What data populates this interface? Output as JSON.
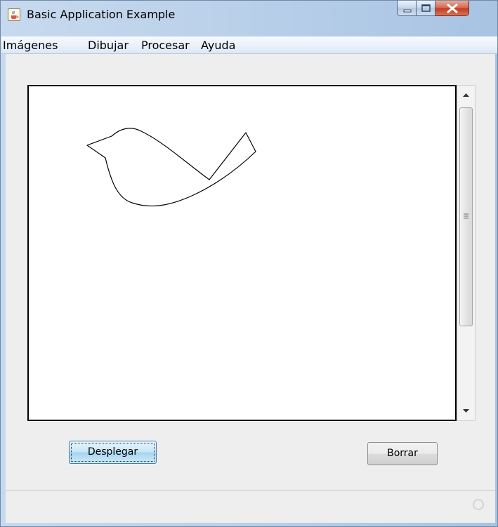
{
  "window": {
    "title": "Basic Application Example",
    "icon": "java-cup-icon"
  },
  "caption_buttons": {
    "minimize": "minimize-icon",
    "maximize": "maximize-icon",
    "close": "close-icon"
  },
  "menubar": {
    "items": [
      {
        "label": "Imágenes"
      },
      {
        "label": "Dibujar"
      },
      {
        "label": "Procesar"
      },
      {
        "label": "Ayuda"
      }
    ]
  },
  "canvas": {
    "drawing": "bird-outline"
  },
  "scrollbar": {
    "up": "scroll-up-arrow-icon",
    "down": "scroll-down-arrow-icon"
  },
  "buttons": {
    "desplegar": "Desplegar",
    "borrar": "Borrar"
  },
  "statusbar": {
    "indicator": "busy-indicator-icon"
  },
  "colors": {
    "canvas_border": "#000000",
    "canvas_bg": "#ffffff",
    "panel_bg": "#eeeeee",
    "close_button": "#c9462a"
  }
}
